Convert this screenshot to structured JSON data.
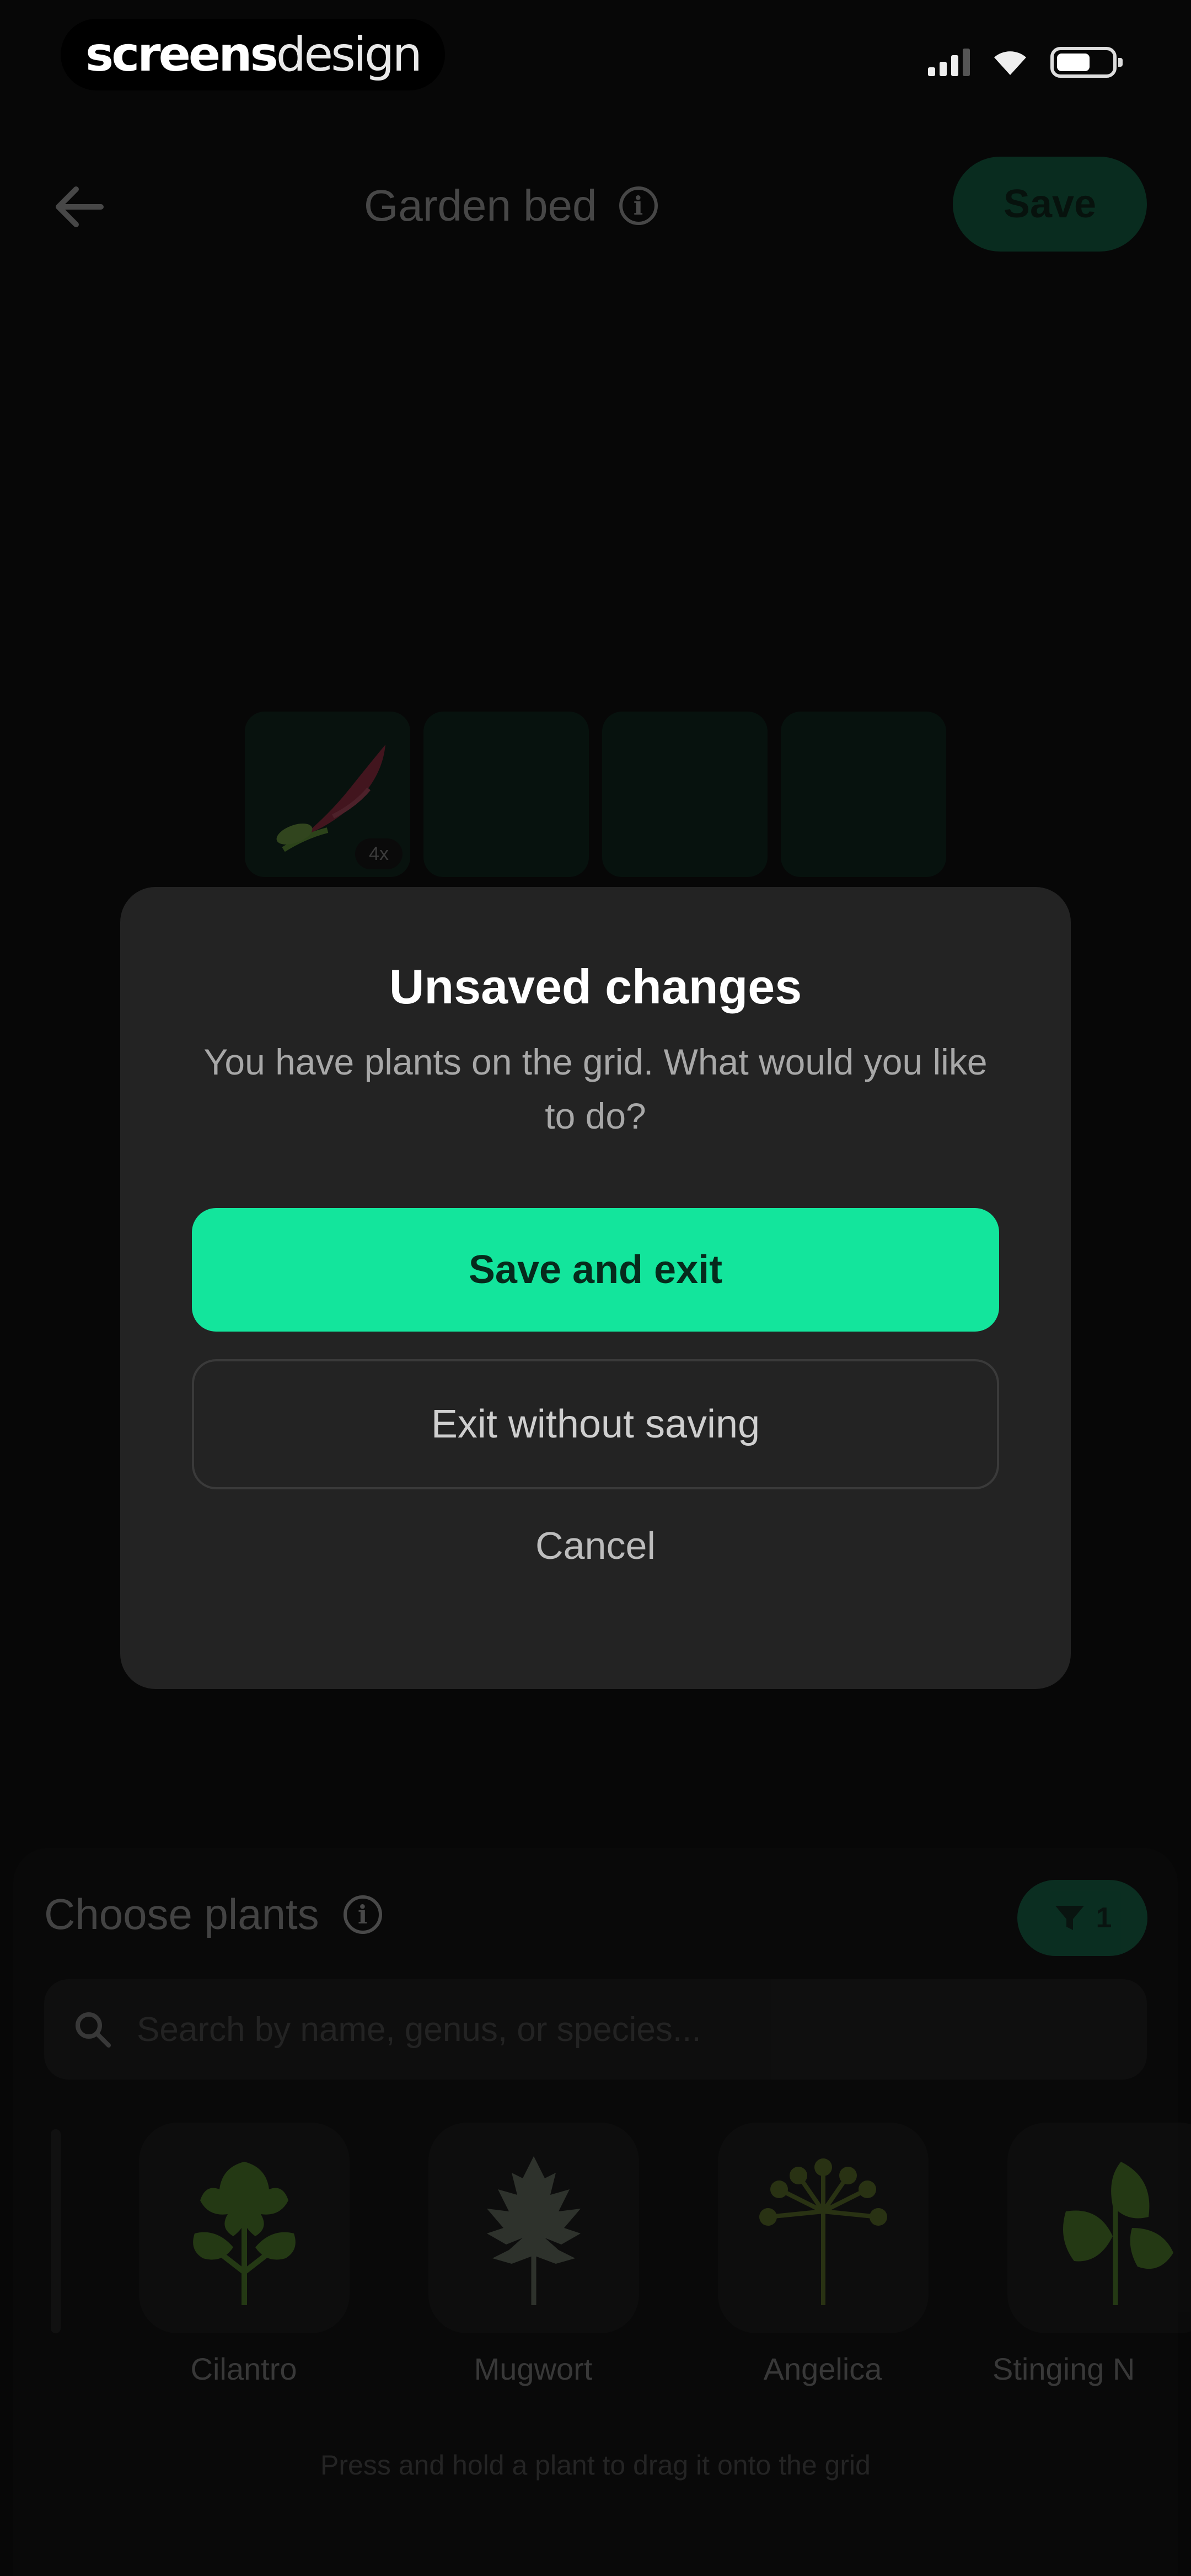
{
  "watermark": {
    "part1": "screens",
    "part2": "design"
  },
  "nav": {
    "title": "Garden bed",
    "save_label": "Save"
  },
  "grid": {
    "first_cell_count": "4x"
  },
  "modal": {
    "title": "Unsaved changes",
    "message": "You have plants on the grid. What would you like to do?",
    "primary_label": "Save and exit",
    "secondary_label": "Exit without saving",
    "cancel_label": "Cancel"
  },
  "panel": {
    "title": "Choose plants",
    "filter_count": "1",
    "search_placeholder": "Search by name, genus, or species...",
    "plants": [
      {
        "name": "Cilantro",
        "icon": "cilantro-icon"
      },
      {
        "name": "Mugwort",
        "icon": "mugwort-icon"
      },
      {
        "name": "Angelica",
        "icon": "angelica-icon"
      },
      {
        "name": "Stinging N",
        "icon": "nettle-icon"
      }
    ],
    "hint": "Press and hold a plant to drag it onto the grid"
  },
  "colors": {
    "accent": "#13e59c",
    "accent_dim": "#0f7c54",
    "modal_bg": "#232323",
    "page_bg": "#070707"
  }
}
